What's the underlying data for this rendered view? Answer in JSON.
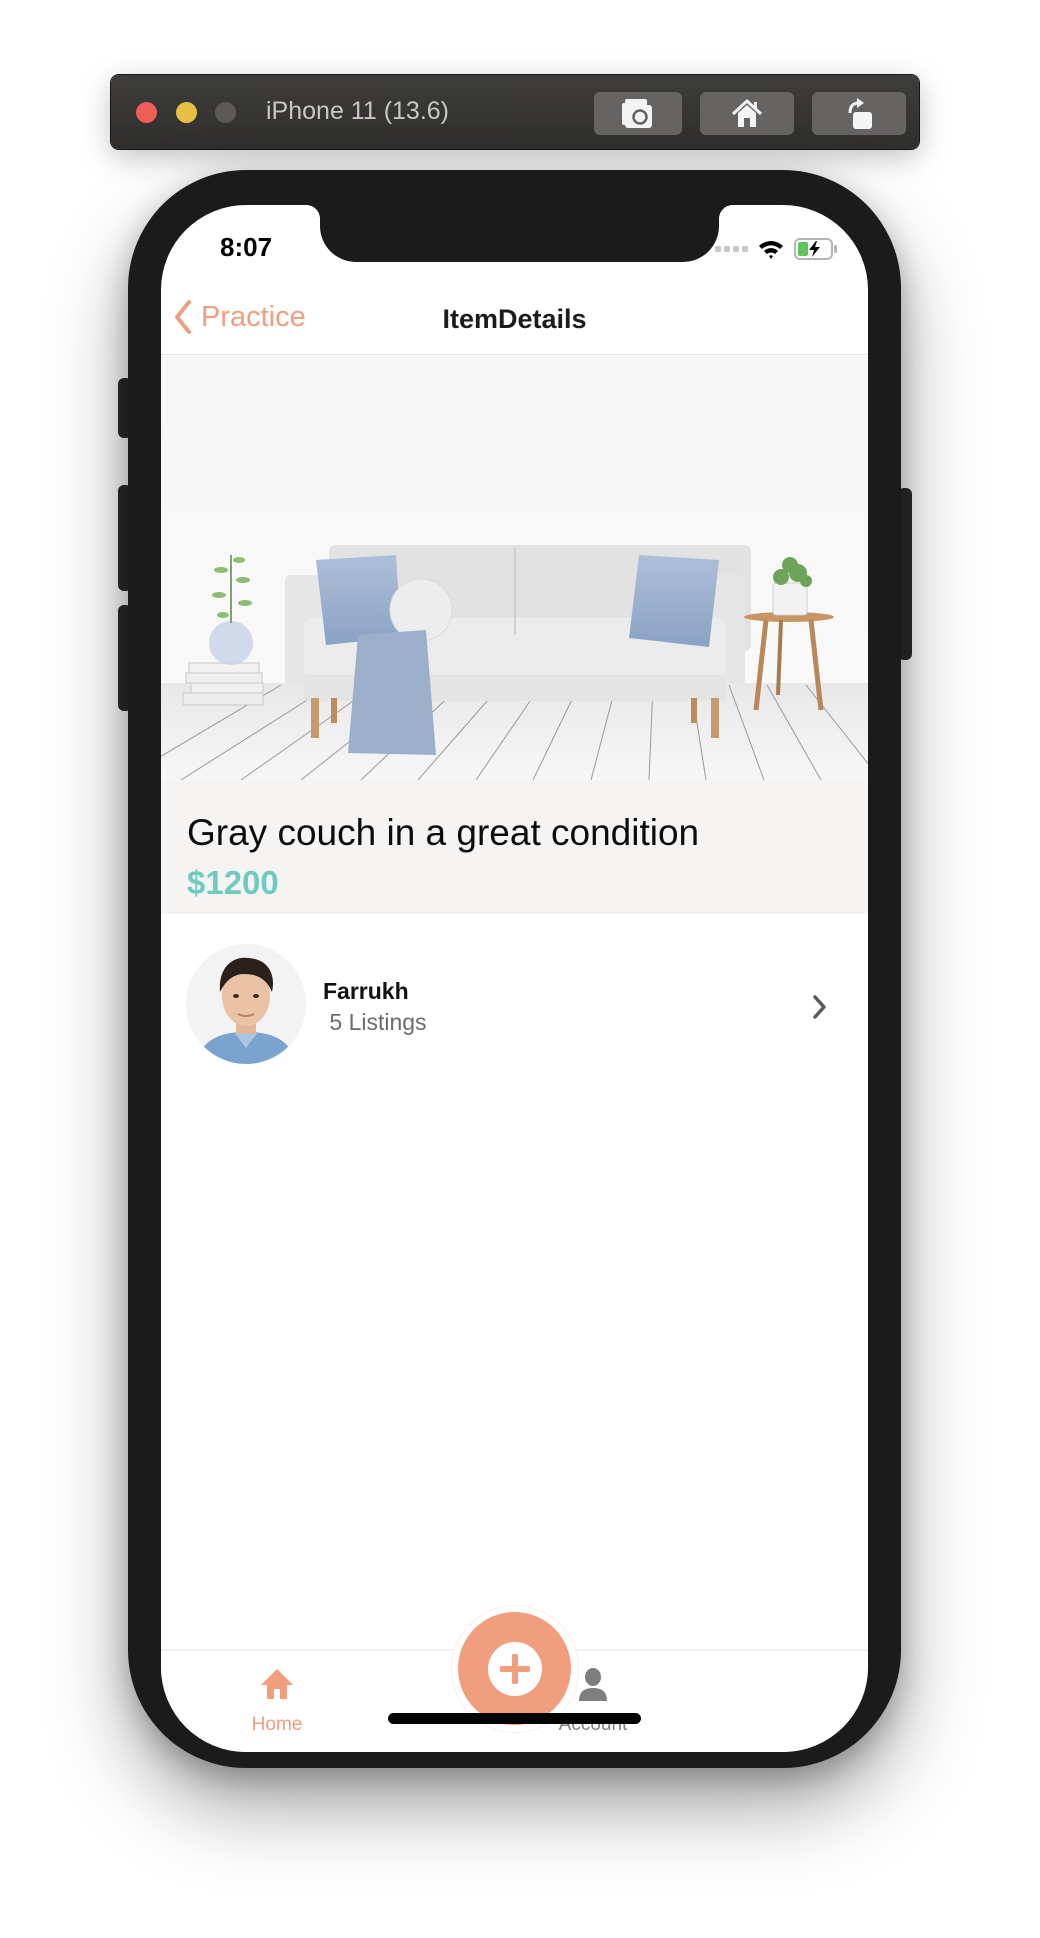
{
  "simulator": {
    "title": "iPhone 11 (13.6)",
    "buttons": [
      {
        "name": "screenshot",
        "icon": "camera-icon"
      },
      {
        "name": "home",
        "icon": "home-icon"
      },
      {
        "name": "rotate",
        "icon": "rotate-icon"
      }
    ]
  },
  "status_bar": {
    "time": "8:07",
    "icons": [
      "cellular-signal-icon",
      "wifi-icon",
      "battery-charging-icon"
    ]
  },
  "nav": {
    "back_label": "Practice",
    "title": "ItemDetails"
  },
  "item": {
    "image_description": "Gray couch with blue pillows and throw in white room",
    "title": "Gray couch in a great condition",
    "price": "$1200"
  },
  "seller": {
    "name": "Farrukh",
    "listings": " 5 Listings"
  },
  "tabbar": {
    "tabs": [
      {
        "label": "Home",
        "icon": "home-icon",
        "active": true
      },
      {
        "label": "Account",
        "icon": "account-icon",
        "active": false
      }
    ],
    "fab_icon": "plus-circle-icon"
  },
  "colors": {
    "accent": "#f19e7f",
    "price": "#6fcac0",
    "inactive": "#7e7e7e",
    "title_block_bg": "#f5f4f2"
  }
}
